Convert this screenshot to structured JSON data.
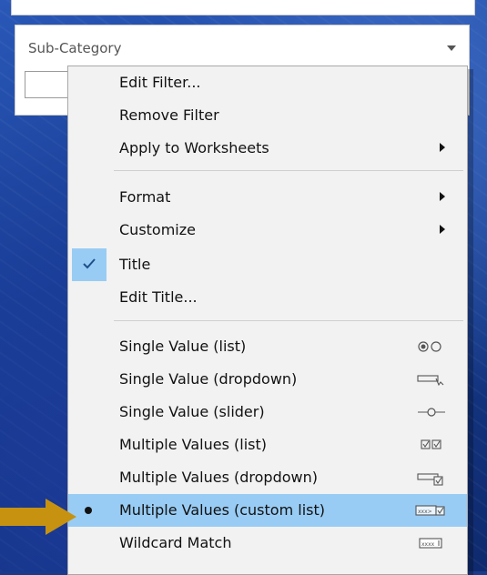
{
  "filter_card": {
    "title": "Sub-Category"
  },
  "menu": {
    "items": [
      {
        "label": "Edit Filter..."
      },
      {
        "label": "Remove Filter"
      },
      {
        "label": "Apply to Worksheets"
      },
      {
        "label": "Format"
      },
      {
        "label": "Customize"
      },
      {
        "label": "Title",
        "checked": true
      },
      {
        "label": "Edit Title..."
      },
      {
        "label": "Single Value (list)",
        "icon": "radio-buttons-icon"
      },
      {
        "label": "Single Value (dropdown)",
        "icon": "dropdown-select-icon"
      },
      {
        "label": "Single Value (slider)",
        "icon": "slider-icon"
      },
      {
        "label": "Multiple Values (list)",
        "icon": "checkboxes-icon"
      },
      {
        "label": "Multiple Values (dropdown)",
        "icon": "dropdown-checkbox-icon"
      },
      {
        "label": "Multiple Values (custom list)",
        "icon": "custom-list-icon",
        "selected": true
      },
      {
        "label": "Wildcard Match",
        "icon": "wildcard-icon"
      }
    ]
  },
  "colors": {
    "highlight": "#99ccf4",
    "menu_bg": "#f2f2f2",
    "pointer": "#c6920f"
  },
  "icon_text": {
    "custom_list": "xxx>",
    "wildcard": "xxxx"
  }
}
